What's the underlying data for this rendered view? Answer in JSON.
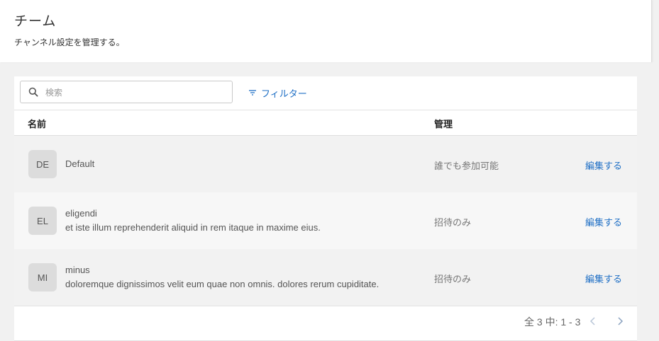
{
  "header": {
    "title": "チーム",
    "subtitle": "チャンネル設定を管理する。"
  },
  "toolbar": {
    "search_placeholder": "検索",
    "search_value": "",
    "filter_label": "フィルター",
    "search_icon": "search-icon",
    "filter_icon": "filter-icon"
  },
  "table": {
    "columns": [
      "名前",
      "管理"
    ],
    "rows": [
      {
        "initials": "DE",
        "name": "Default",
        "description": "",
        "management": "誰でも参加可能",
        "action": "編集する"
      },
      {
        "initials": "EL",
        "name": "eligendi",
        "description": "et iste illum reprehenderit aliquid in rem itaque in maxime eius.",
        "management": "招待のみ",
        "action": "編集する"
      },
      {
        "initials": "MI",
        "name": "minus",
        "description": "doloremque dignissimos velit eum quae non omnis. dolores rerum cupiditate.",
        "management": "招待のみ",
        "action": "編集する"
      }
    ]
  },
  "pagination": {
    "info": "全 3 中: 1 - 3",
    "prev_icon": "chevron-left-icon",
    "next_icon": "chevron-right-icon"
  },
  "colors": {
    "accent": "#1f6fc5",
    "background": "#f1f1f1",
    "row_background": "#f2f2f2",
    "avatar_background": "#dcdcdc"
  }
}
